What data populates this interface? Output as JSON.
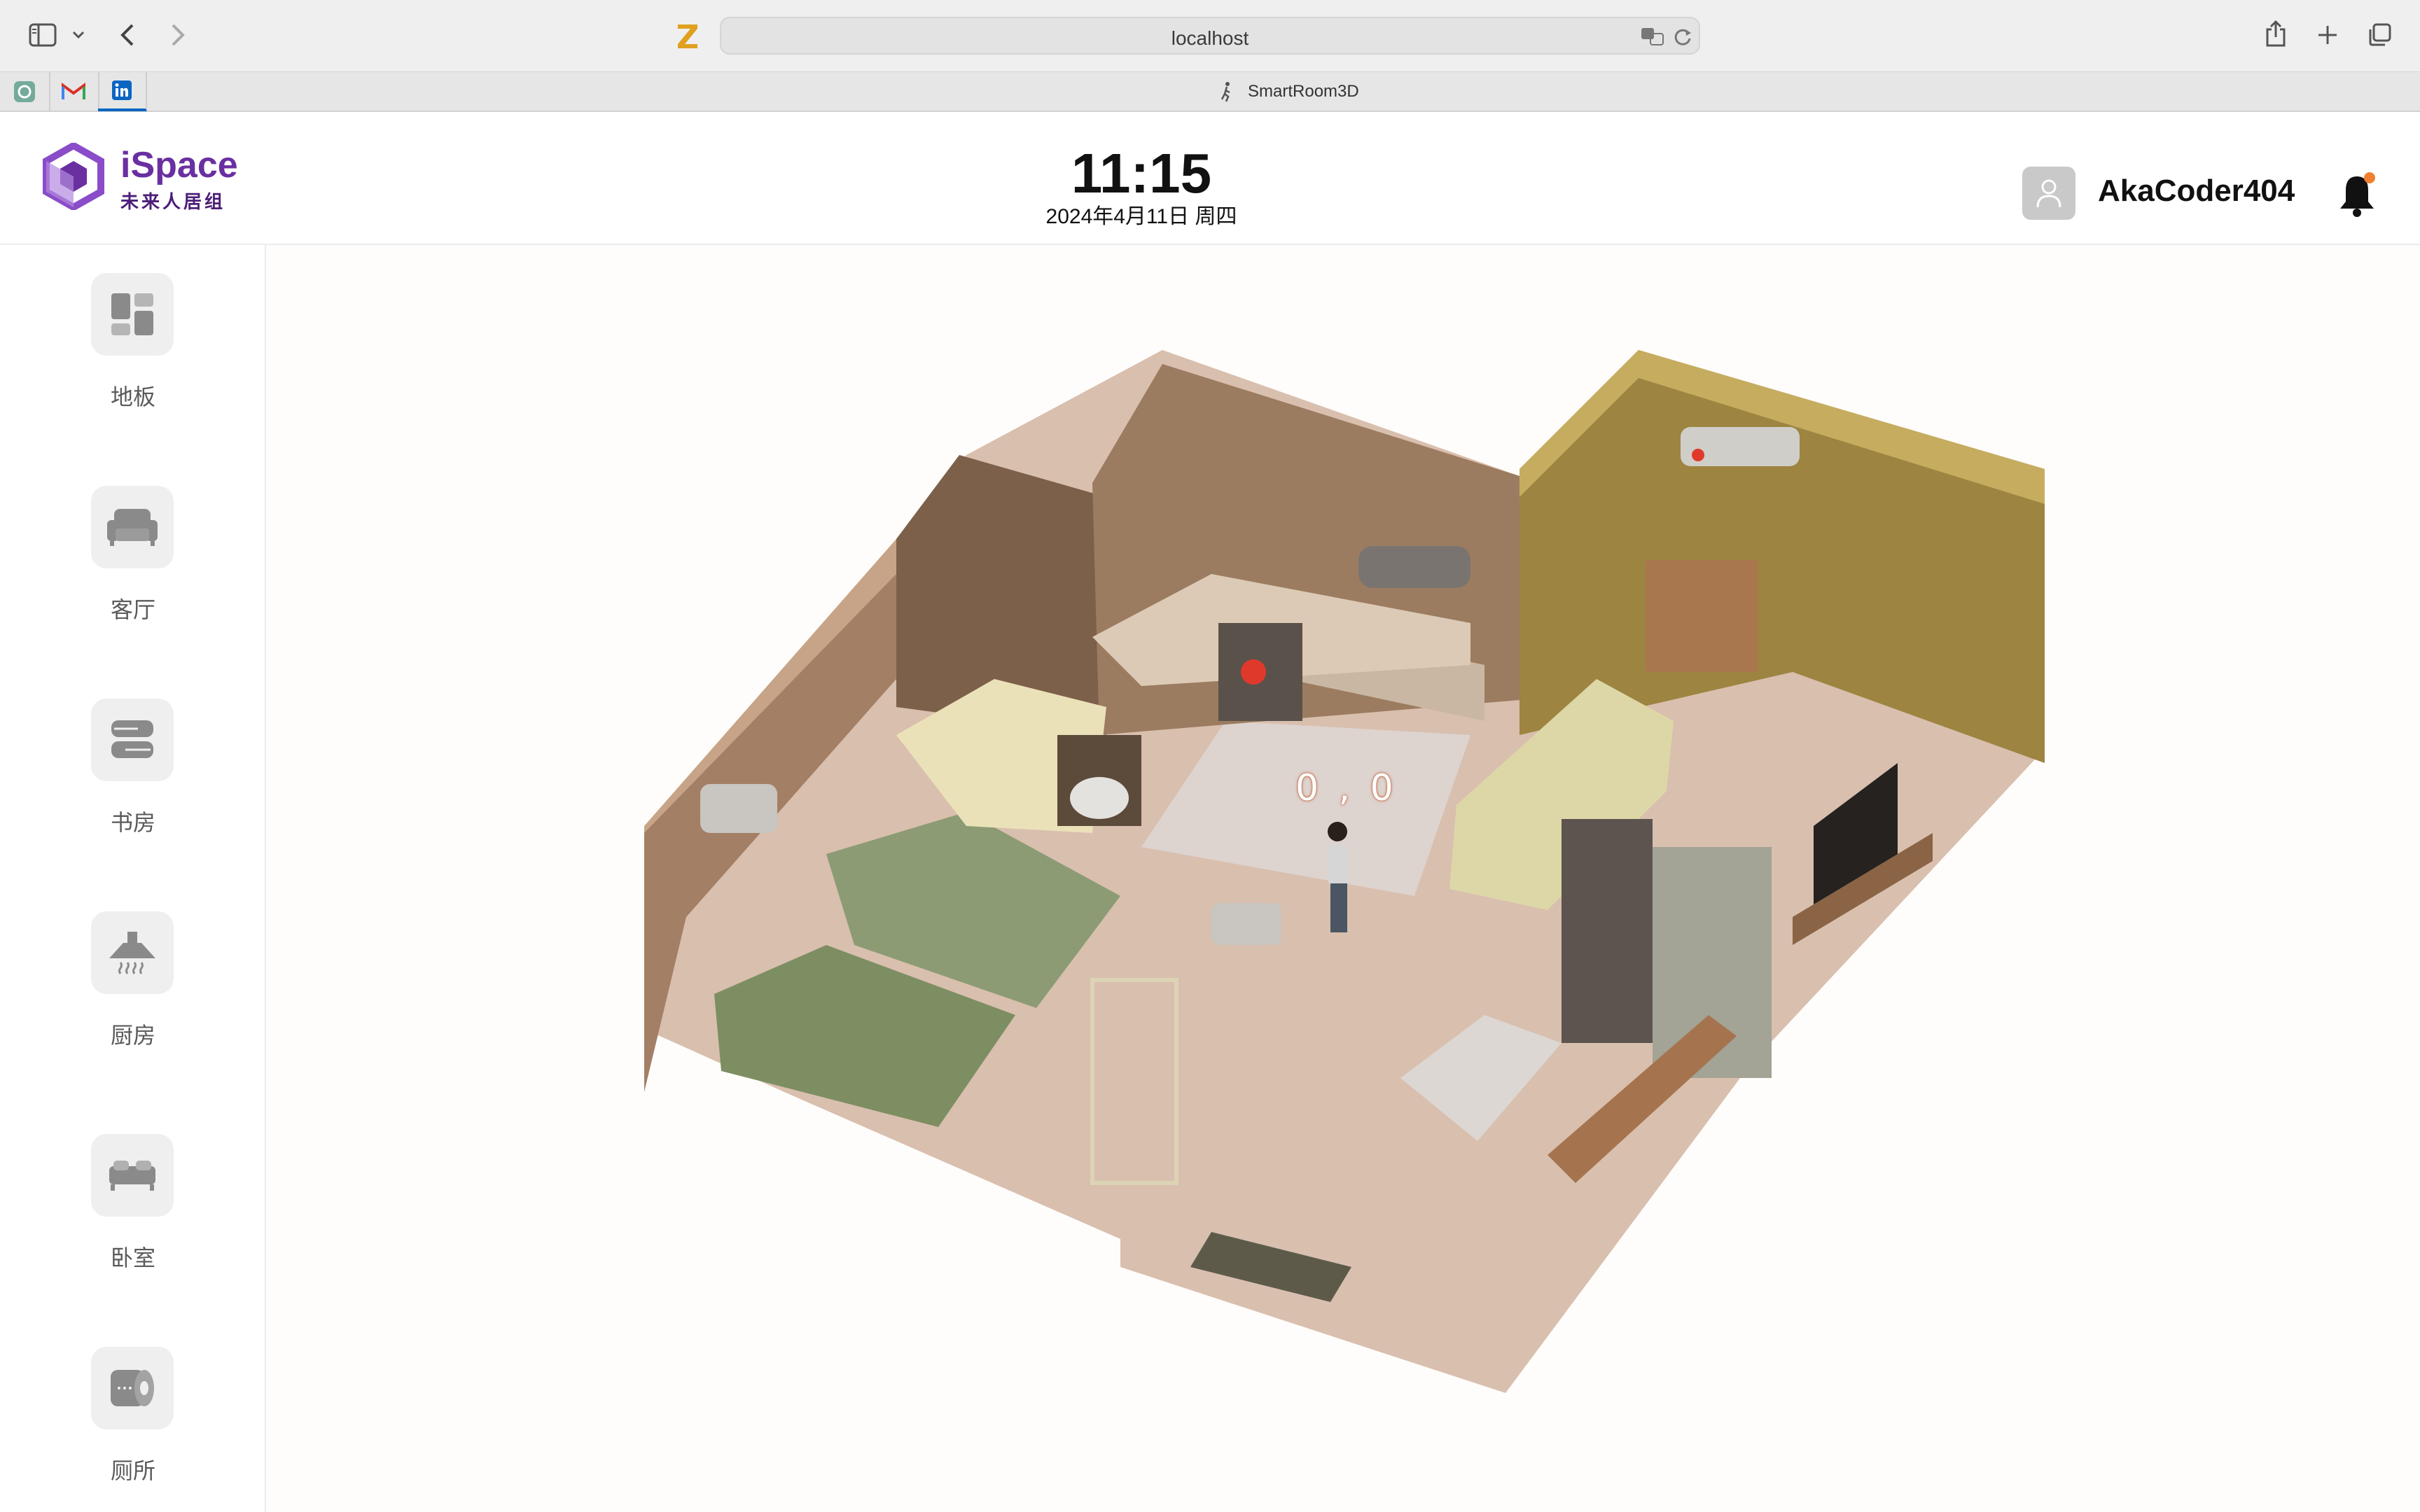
{
  "browser": {
    "url": "localhost",
    "tab_title": "SmartRoom3D",
    "pinned_tabs": [
      {
        "icon": "chatgpt-icon"
      },
      {
        "icon": "gmail-icon"
      },
      {
        "icon": "linkedin-icon"
      }
    ]
  },
  "header": {
    "logo_wordmark": "iSpace",
    "logo_subtitle": "未来人居组",
    "time": "11:15",
    "date": "2024年4月11日 周四",
    "username": "AkaCoder404",
    "notification_dot_color": "#f08030"
  },
  "sidebar": {
    "items": [
      {
        "label": "地板",
        "icon": "floor-icon"
      },
      {
        "label": "客厅",
        "icon": "sofa-icon"
      },
      {
        "label": "书房",
        "icon": "books-icon"
      },
      {
        "label": "厨房",
        "icon": "range-hood-icon"
      },
      {
        "label": "卧室",
        "icon": "bed-icon"
      },
      {
        "label": "厕所",
        "icon": "toilet-paper-icon"
      }
    ]
  },
  "scene": {
    "origin_label": "0 , 0"
  }
}
